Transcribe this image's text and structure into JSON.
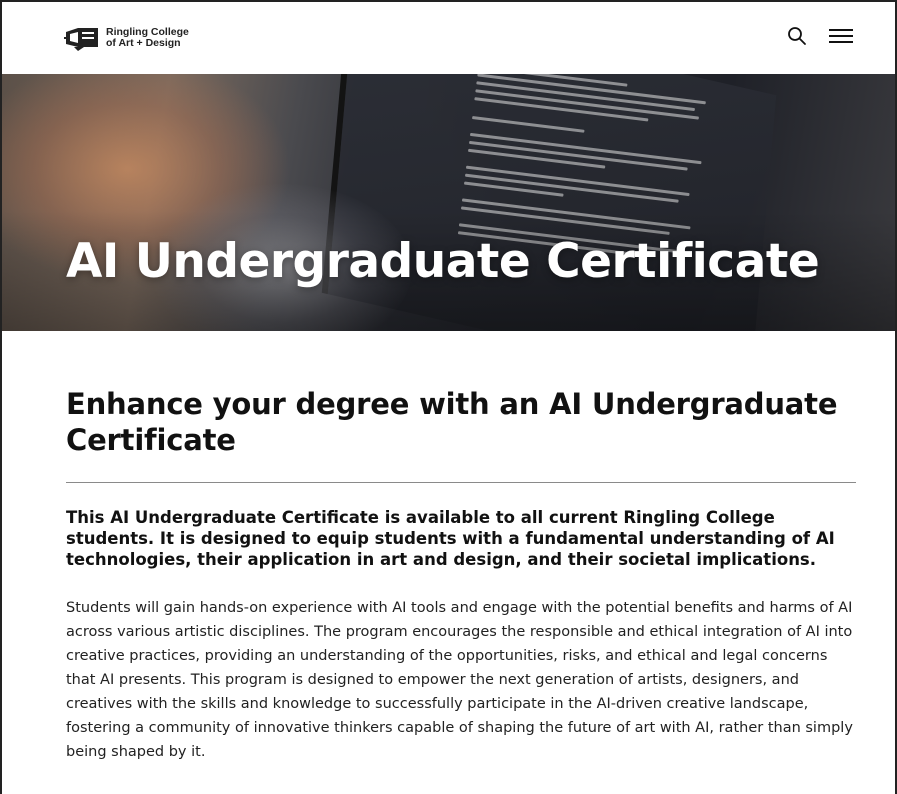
{
  "header": {
    "logo_line1": "Ringling College",
    "logo_line2": "of Art + Design",
    "search_icon": "search-icon",
    "menu_icon": "hamburger-menu-icon"
  },
  "hero": {
    "title": "AI Undergraduate Certificate"
  },
  "main": {
    "section_title": "Enhance your degree with an AI Undergraduate Certificate",
    "lead": "This AI Undergraduate Certificate is available to all current Ringling College students. It is designed to equip students with a fundamental understanding of AI technologies, their application in art and design, and their societal implications.",
    "body": "Students will gain hands-on experience with AI tools and engage with the potential benefits and harms of AI across various artistic disciplines. The program encourages the responsible and ethical integration of AI into creative practices, providing an understanding of the opportunities, risks, and ethical and legal concerns that AI presents. This program is designed to empower the next generation of artists, designers, and creatives with the skills and knowledge to successfully participate in the AI-driven creative landscape, fostering a community of innovative thinkers capable of shaping the future of art with AI, rather than simply being shaped by it."
  }
}
